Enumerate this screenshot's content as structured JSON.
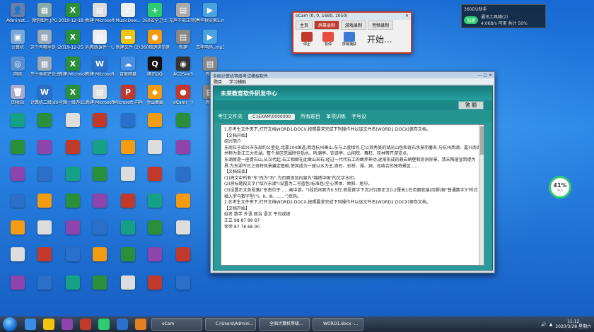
{
  "desktop_icons": [
    {
      "label": "Administ...",
      "color": "#6a7fa8",
      "glyph": "👤"
    },
    {
      "label": "微信图片.JPG",
      "color": "#8aa",
      "glyph": "▦"
    },
    {
      "label": "2019-12-18 全国...",
      "color": "#2a8f3a",
      "glyph": "X"
    },
    {
      "label": "新建 Microsoft...",
      "color": "#ddd",
      "glyph": "▤"
    },
    {
      "label": "MusicDow...",
      "color": "#eee",
      "glyph": "♪"
    },
    {
      "label": "360安全卫士",
      "color": "#2ecc71",
      "glyph": "+"
    },
    {
      "label": "无声不能正常(F)...",
      "color": "#aaa",
      "glyph": "▤"
    },
    {
      "label": "春华秋实第1.mp3",
      "color": "#4aa3df",
      "glyph": "▶"
    },
    {
      "label": "计算机",
      "color": "#7aa7d8",
      "glyph": "▣"
    },
    {
      "label": "这个有哪里是 请可.jpg",
      "color": "#9ab",
      "glyph": "▦"
    },
    {
      "label": "2019-12-25 全国...",
      "color": "#2a8f3a",
      "glyph": "X"
    },
    {
      "label": "人教版课件一(上)",
      "color": "#eee",
      "glyph": "▤"
    },
    {
      "label": "新建文件 (2)",
      "color": "#f1c40f",
      "glyph": "▬"
    },
    {
      "label": "360极速浏览器",
      "color": "#f39c12",
      "glyph": "●"
    },
    {
      "label": "新建",
      "color": "#888",
      "glyph": "▤"
    },
    {
      "label": "去年电码 .mp3",
      "color": "#4aa3df",
      "glyph": "▶"
    },
    {
      "label": "网络",
      "color": "#5a8fd0",
      "glyph": "◎"
    },
    {
      "label": "先十类和评论主(件)2.jpg",
      "color": "#9ab",
      "glyph": "▦"
    },
    {
      "label": "新建 Microsoft...",
      "color": "#2a8f3a",
      "glyph": "X"
    },
    {
      "label": "新建 Microsoft...",
      "color": "#2a6fc9",
      "glyph": "W"
    },
    {
      "label": "百度网盘",
      "color": "#4a90e2",
      "glyph": "☁"
    },
    {
      "label": "腾讯QQ",
      "color": "#111",
      "glyph": "Q"
    },
    {
      "label": "ACDSee5",
      "color": "#333",
      "glyph": "◉"
    },
    {
      "label": "新建",
      "color": "#888",
      "glyph": "▤"
    },
    {
      "label": "回收站",
      "color": "#aac",
      "glyph": "🗑"
    },
    {
      "label": "计算机二级.doc",
      "color": "#2a6fc9",
      "glyph": "W"
    },
    {
      "label": "全国一级办公.doc",
      "color": "#2a8f3a",
      "glyph": "X"
    },
    {
      "label": "新建 Microsoft...",
      "color": "#ddd",
      "glyph": "▤"
    },
    {
      "label": "Microsoft 内容",
      "color": "#c0392b",
      "glyph": "P"
    },
    {
      "label": "金山毒霸",
      "color": "#f39c12",
      "glyph": "◆"
    },
    {
      "label": "oCam(一)",
      "color": "#c0392b",
      "glyph": "●"
    },
    {
      "label": "新建",
      "color": "#888",
      "glyph": "▤"
    }
  ],
  "ocam": {
    "title": "oCam (0, 0, 1680, 1050)",
    "tabs": [
      "主页",
      "屏幕录制",
      "游戏录制",
      "音频录制"
    ],
    "active_tab": 1,
    "tools": [
      "停止",
      "暂停",
      "屏幕捕获"
    ],
    "start_label": "开始..."
  },
  "widget360": {
    "title": "360DU助手",
    "line1": "通讯工具箱(2)",
    "line2": "4.0KB/s 可用 共计 50%",
    "btn": "加速"
  },
  "main_window": {
    "title": "全国计算机等级考试模拟软件",
    "menu": [
      "题目",
      "学习辅助"
    ],
    "brand": "未来教育软件研发中心",
    "mini_button": "答 题",
    "toolbar": {
      "label": "考生文件夹",
      "path": "C:\\EXAM\\0000000",
      "items": [
        "所有题目",
        "单项训练",
        "字号设"
      ]
    },
    "document": [
      "1.在考生文件夹下,打开文档WORD1.DOCX,按照要求完成下列操作并以该文件名(WORD1.DOCX)保存文档。",
      "【文档开始】",
      "绍兴简介",
      "东南位于绍兴市东部约公里处,北靠104国道,西连杭州萧山,东与上虞相邻,它以其秀美的湖光山色和奇石水景而著名,与杭州西湖、嘉兴南湖并称为浙江三大名湖。整个景区范围除包括水、听潮亭、钦译亭、山阴院、舞柱、桂林等开游览点。",
      "东湖原是一座青石山,从汉代起,石工相继在此凿山采石,经过一代代石工的凿斧神功,逐渐形成的悬岩峭壁和奇洞异景。清末陶濬宣筑堤为界,为东湖今日之奇特风景奠定基础,使其成为一座以水为主,奇石、虹桥、湖、洞、岛结合的独特景区……",
      "【文档结束】",
      "(1)将文中所有\"东\"改为\"石\",为页面添加内容为\"锦绣中国\"的文字水印。",
      "(2)将标题段文字(\"绍兴东湖\")设置为二号蓝色(标准色)空心黑体、倾斜、居中。",
      "(3)设置正文各段落(\"东南位于……画中游。\")段后间距为0.5行;首段首字下沉2行(距正文0.2厘米);在页面底端(页脚)按\"普通数字3\"样式插入罗马数字型(\"Ⅰ、Ⅱ、Ⅲ、……\")页码。",
      "2.在考生文件夹下,打开文档WORD2.DOCX,按照要求完成下列操作并以该文件名(WORD2.DOCX)保存文档。",
      "【文档开始】",
      "姓名 数学 外语 政治 语文 平均成绩",
      "王立 98 87 89 87",
      "李萍 87 78 68 90"
    ]
  },
  "battery": {
    "percent": "41%",
    "sub": "0K/s"
  },
  "taskbar": {
    "tasks": [
      "oCam",
      "C:\\Users\\Admini...",
      "全国计算机等级...",
      "WORD1.docx -..."
    ],
    "time": "11:12",
    "date": "2020/3/28 星期六"
  }
}
